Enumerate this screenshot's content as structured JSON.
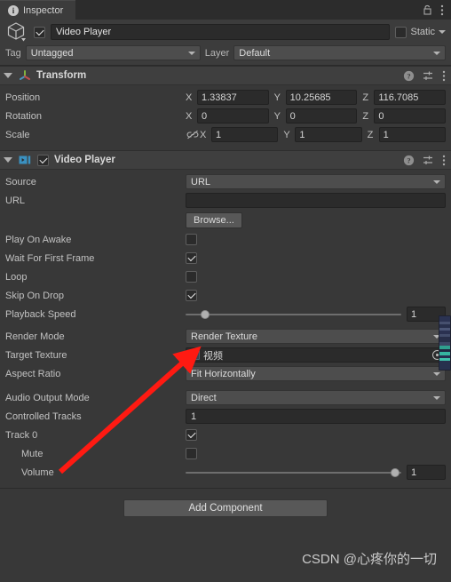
{
  "window": {
    "tab_label": "Inspector",
    "tab_icon": "info-icon",
    "lock_icon": "lock-icon",
    "menu_icon": "kebab-menu-icon"
  },
  "gameobject": {
    "enabled": true,
    "icon": "cube-icon",
    "name": "Video Player",
    "static_label": "Static",
    "static_checked": false,
    "tag_label": "Tag",
    "tag_value": "Untagged",
    "layer_label": "Layer",
    "layer_value": "Default"
  },
  "transform": {
    "title": "Transform",
    "icon": "transform-axis-icon",
    "help_icon": "help-icon",
    "preset_icon": "preset-sliders-icon",
    "menu_icon": "kebab-menu-icon",
    "rows": [
      {
        "label": "Position",
        "x": "1.33837",
        "y": "10.25685",
        "z": "116.7085",
        "has_link": false
      },
      {
        "label": "Rotation",
        "x": "0",
        "y": "0",
        "z": "0",
        "has_link": false
      },
      {
        "label": "Scale",
        "x": "1",
        "y": "1",
        "z": "1",
        "has_link": true,
        "link_icon": "link-broken-icon"
      }
    ],
    "axis_x": "X",
    "axis_y": "Y",
    "axis_z": "Z"
  },
  "video_player": {
    "title": "Video Player",
    "icon": "video-player-icon",
    "enabled": true,
    "help_icon": "help-icon",
    "preset_icon": "preset-sliders-icon",
    "menu_icon": "kebab-menu-icon",
    "source_label": "Source",
    "source_value": "URL",
    "url_label": "URL",
    "url_value": "",
    "browse_label": "Browse...",
    "play_on_awake_label": "Play On Awake",
    "play_on_awake": false,
    "wait_first_frame_label": "Wait For First Frame",
    "wait_first_frame": true,
    "loop_label": "Loop",
    "loop": false,
    "skip_on_drop_label": "Skip On Drop",
    "skip_on_drop": true,
    "playback_speed_label": "Playback Speed",
    "playback_speed_value": "1",
    "playback_speed_pct": 9,
    "render_mode_label": "Render Mode",
    "render_mode_value": "Render Texture",
    "target_texture_label": "Target Texture",
    "target_texture_value": "视频",
    "target_texture_icon": "render-texture-icon",
    "target_texture_picker": "object-picker-icon",
    "aspect_ratio_label": "Aspect Ratio",
    "aspect_ratio_value": "Fit Horizontally",
    "audio_output_mode_label": "Audio Output Mode",
    "audio_output_mode_value": "Direct",
    "controlled_tracks_label": "Controlled Tracks",
    "controlled_tracks_value": "1",
    "track0_label": "Track 0",
    "track0": true,
    "mute_label": "Mute",
    "mute": false,
    "volume_label": "Volume",
    "volume_value": "1",
    "volume_pct": 97
  },
  "footer": {
    "add_component_label": "Add Component"
  },
  "annotation": {
    "arrow_color": "#FF1A12",
    "watermark": "CSDN @心疼你的一切"
  },
  "colors": {
    "background": "#383838",
    "panel_header": "#3f3f3f",
    "field_dark": "#2b2b2b",
    "dropdown": "#4d4d4d",
    "accent_blue": "#3aa0d8",
    "text": "#c4c4c4"
  }
}
